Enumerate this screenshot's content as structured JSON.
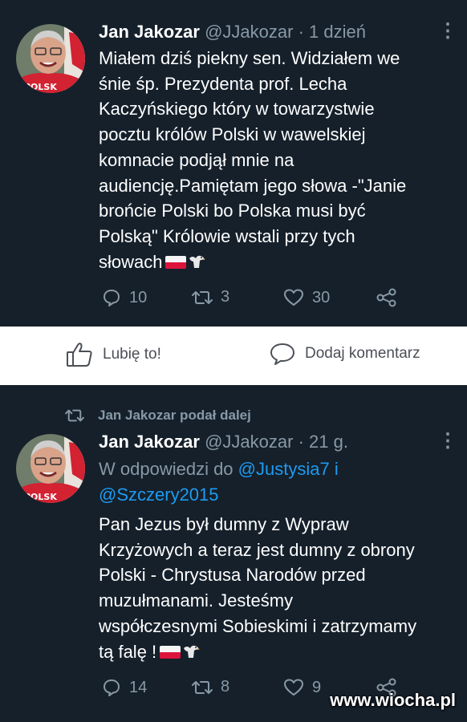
{
  "tweet1": {
    "author_name": "Jan Jakozar",
    "handle": "@JJakozar",
    "separator": "·",
    "time": "1 dzień",
    "lines": [
      "Miałem dziś piekny sen. Widziałem we",
      "śnie śp. Prezydenta prof. Lecha",
      "Kaczyńskiego który w towarzystwie",
      "pocztu królów Polski w wawelskiej",
      "komnacie podjął mnie na",
      "audiencję.Pamiętam jego słowa -\"Janie",
      "brońcie Polski bo Polska musi być",
      "Polską\" Królowie wstali przy tych",
      "słowach"
    ],
    "avatar_shirt_text": "POLSK",
    "replies": "10",
    "retweets": "3",
    "likes": "30"
  },
  "facebook_bar": {
    "like_label": "Lubię to!",
    "comment_label": "Dodaj komentarz"
  },
  "tweet2": {
    "retweeted_by": "Jan Jakozar podał dalej",
    "author_name": "Jan Jakozar",
    "handle": "@JJakozar",
    "separator": "·",
    "time": "21 g.",
    "reply_prefix": "W odpowiedzi do",
    "reply_mention1": "@Justysia7",
    "reply_and": "i",
    "reply_mention2": "@Szczery2015",
    "lines": [
      "Pan Jezus był dumny z Wypraw",
      "Krzyżowych a teraz jest dumny z obrony",
      "Polski - Chrystusa Narodów przed",
      "muzułmanami. Jesteśmy",
      "współczesnymi Sobieskimi i zatrzymamy",
      "tą falę !"
    ],
    "avatar_shirt_text": "POLSK",
    "replies": "14",
    "retweets": "8",
    "likes": "9"
  },
  "watermark": "www.wiocha.pl",
  "colors": {
    "tweet_bg": "#15202b",
    "muted": "#8899a6",
    "link": "#1d9bf0",
    "flag_red": "#dc143c"
  }
}
